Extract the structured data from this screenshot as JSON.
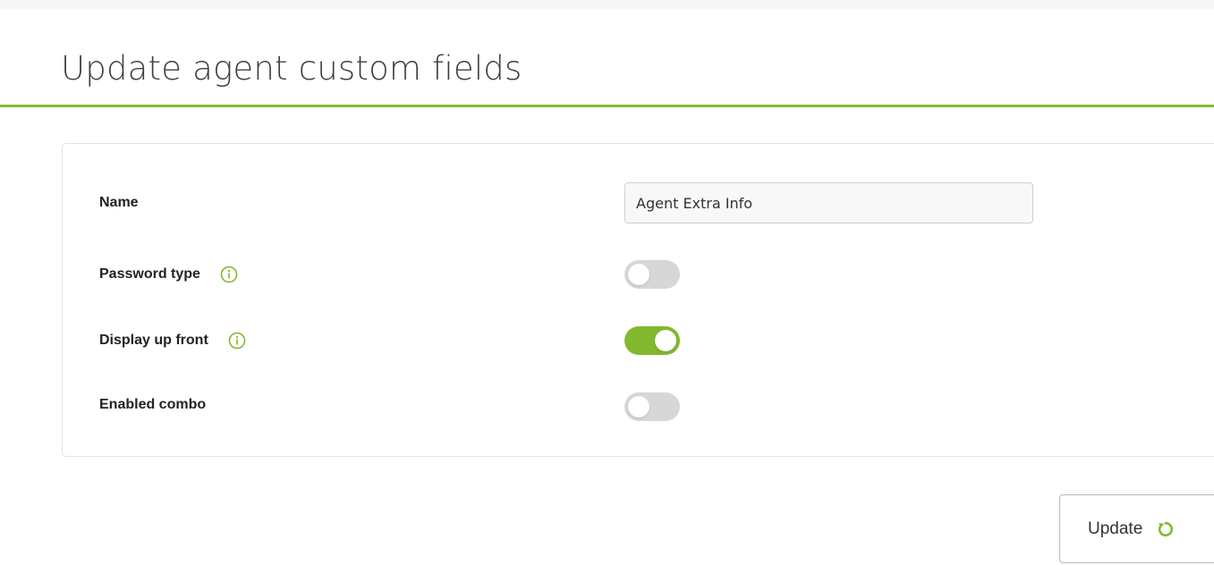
{
  "page": {
    "title": "Update agent custom fields"
  },
  "form": {
    "name": {
      "label": "Name",
      "value": "Agent Extra Info"
    },
    "password_type": {
      "label": "Password type",
      "enabled": false,
      "icon": "info-icon"
    },
    "display_up_front": {
      "label": "Display up front",
      "enabled": true,
      "icon": "info-icon"
    },
    "enabled_combo": {
      "label": "Enabled combo",
      "enabled": false
    }
  },
  "actions": {
    "update_label": "Update",
    "update_icon": "refresh-icon"
  },
  "colors": {
    "accent": "#82b92e",
    "switch_off": "#d7d7d7"
  }
}
